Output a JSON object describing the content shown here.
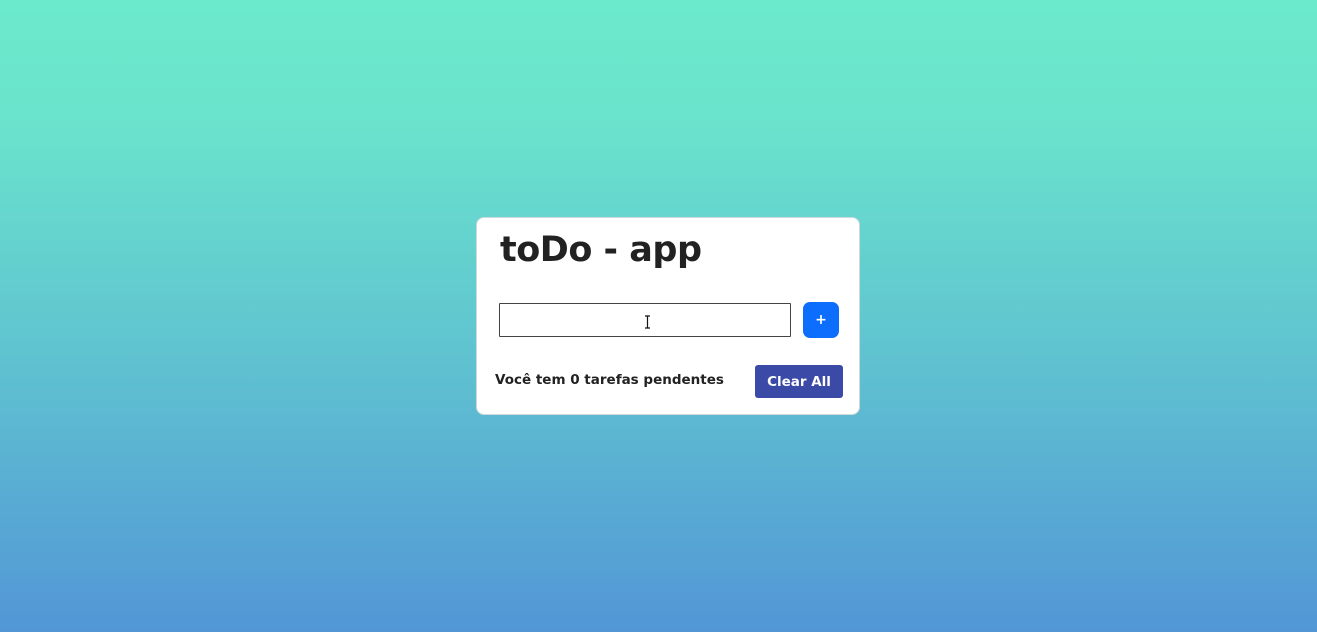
{
  "app": {
    "title": "toDo - app"
  },
  "input": {
    "value": "",
    "placeholder": ""
  },
  "add_button": {
    "label": "+"
  },
  "footer": {
    "pending_text": "Você tem 0 tarefas pendentes",
    "clear_label": "Clear All"
  },
  "colors": {
    "background_top": "#6ceacc",
    "background_bottom": "#5296d6",
    "add_button": "#0d6efd",
    "clear_button": "#3a4aa6",
    "text": "#222222"
  },
  "icons": {
    "text_cursor": "text-cursor-icon"
  }
}
